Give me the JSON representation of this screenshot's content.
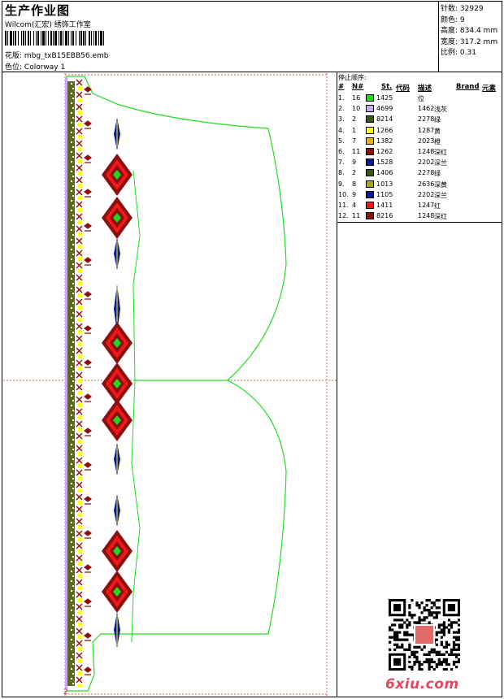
{
  "header": {
    "title": "生产作业图",
    "subtitle": "Wilcom(汇宏) 绣饰工作室",
    "pattern_label": "花版:",
    "pattern_value": "mbg_txB15EBB56.emb",
    "colorway_label": "色位:",
    "colorway_value": "Colorway 1"
  },
  "stats": {
    "stitches_label": "针数:",
    "stitches_value": "32929",
    "colors_label": "颜色:",
    "colors_value": "9",
    "height_label": "高度:",
    "height_value": "834.4 mm",
    "width_label": "宽度:",
    "width_value": "317.2 mm",
    "scale_label": "比例:",
    "scale_value": "0.31"
  },
  "legend": {
    "stop_sequence_label": "停止顺序:",
    "headers": {
      "num": "#",
      "needle": "N#",
      "st": "St.",
      "code": "代码",
      "desc": "描述",
      "brand": "Brand",
      "element": "元素"
    },
    "rows": [
      {
        "num": "1.",
        "needle": "16",
        "color": "#20d820",
        "st": "1425",
        "code": "",
        "desc": "位"
      },
      {
        "num": "2.",
        "needle": "10",
        "color": "#c8a8f0",
        "st": "4699",
        "code": "1462",
        "desc": "浅灰"
      },
      {
        "num": "3.",
        "needle": "2",
        "color": "#3a5a14",
        "st": "8214",
        "code": "2278",
        "desc": "绿"
      },
      {
        "num": "4.",
        "needle": "1",
        "color": "#ffff20",
        "st": "1266",
        "code": "1287",
        "desc": "黄"
      },
      {
        "num": "5.",
        "needle": "7",
        "color": "#e8b020",
        "st": "1382",
        "code": "2023",
        "desc": "橙"
      },
      {
        "num": "6.",
        "needle": "11",
        "color": "#8a1010",
        "st": "1262",
        "code": "1248",
        "desc": "深红"
      },
      {
        "num": "7.",
        "needle": "9",
        "color": "#101a8a",
        "st": "1528",
        "code": "2202",
        "desc": "深兰"
      },
      {
        "num": "8.",
        "needle": "2",
        "color": "#3a5a14",
        "st": "1406",
        "code": "2278",
        "desc": "绿"
      },
      {
        "num": "9.",
        "needle": "8",
        "color": "#a8a820",
        "st": "1013",
        "code": "2636",
        "desc": "深黄"
      },
      {
        "num": "10.",
        "needle": "9",
        "color": "#101a8a",
        "st": "1105",
        "code": "2202",
        "desc": "深兰"
      },
      {
        "num": "11.",
        "needle": "4",
        "color": "#f01818",
        "st": "1411",
        "code": "1247",
        "desc": "红"
      },
      {
        "num": "12.",
        "needle": "11",
        "color": "#8a1010",
        "st": "8216",
        "code": "1248",
        "desc": "深红"
      }
    ]
  },
  "design": {
    "corner_marker": "2",
    "outline_color": "#22dd22",
    "guide_color": "#e06060"
  },
  "watermark": {
    "site_text": "6xiu.com"
  }
}
